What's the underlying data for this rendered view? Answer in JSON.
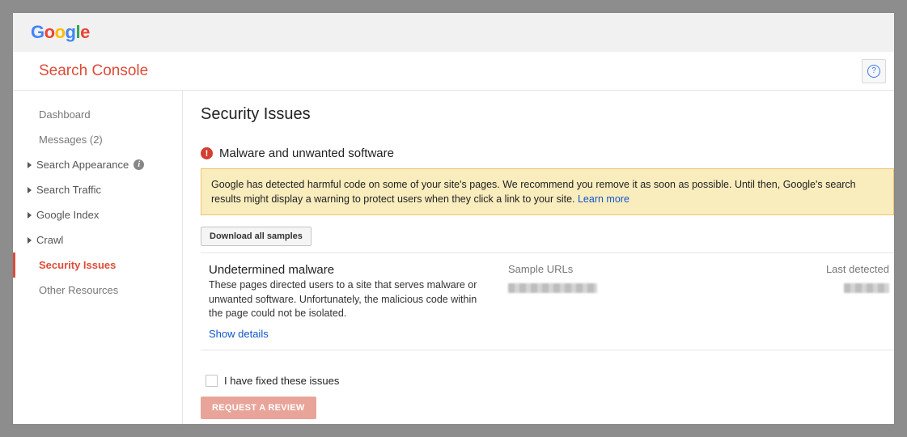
{
  "header": {
    "product": "Search Console"
  },
  "sidebar": {
    "items": [
      {
        "label": "Dashboard",
        "kind": "indent"
      },
      {
        "label": "Messages (2)",
        "kind": "indent"
      },
      {
        "label": "Search Appearance",
        "kind": "expand",
        "info": true
      },
      {
        "label": "Search Traffic",
        "kind": "expand"
      },
      {
        "label": "Google Index",
        "kind": "expand"
      },
      {
        "label": "Crawl",
        "kind": "expand"
      },
      {
        "label": "Security Issues",
        "kind": "indent",
        "active": true
      },
      {
        "label": "Other Resources",
        "kind": "indent"
      }
    ]
  },
  "page": {
    "title": "Security Issues",
    "issue_heading": "Malware and unwanted software",
    "notice_text": "Google has detected harmful code on some of your site's pages. We recommend you remove it as soon as possible. Until then, Google's search results might display a warning to protect users when they click a link to your site. ",
    "notice_link": "Learn more",
    "download_label": "Download all samples",
    "columns": {
      "sample": "Sample URLs",
      "last": "Last detected"
    },
    "detail": {
      "name": "Undetermined malware",
      "text": "These pages directed users to a site that serves malware or unwanted software. Unfortunately, the malicious code within the page could not be isolated.",
      "show": "Show details"
    },
    "fixed_label": "I have fixed these issues",
    "review_label": "REQUEST A REVIEW"
  }
}
